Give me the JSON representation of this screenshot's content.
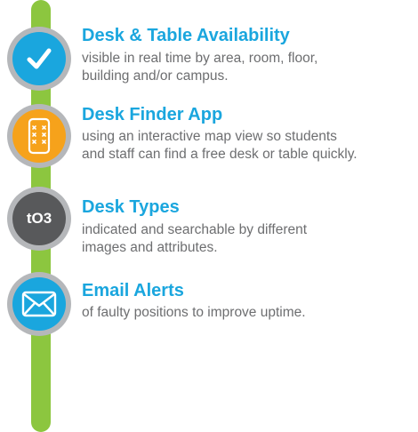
{
  "colors": {
    "rail": "#8cc63f",
    "title": "#1aa6de",
    "text": "#6d6e70",
    "ring": "#b5b7ba",
    "badge_blue": "#1aa6de",
    "badge_orange": "#f6a21b",
    "badge_dark": "#58595b"
  },
  "features": [
    {
      "icon": "checkmark-icon",
      "title": "Desk & Table Availability",
      "lines": [
        "visible in real time by area, room, floor,",
        "building and/or campus."
      ]
    },
    {
      "icon": "phone-app-icon",
      "title": "Desk Finder App",
      "lines": [
        "using an interactive map view so students",
        "and staff can find a free desk or table quickly."
      ]
    },
    {
      "icon": "brand-logo-icon",
      "icon_text": "tO3",
      "title": "Desk Types",
      "lines": [
        "indicated and searchable by different",
        "images and attributes."
      ]
    },
    {
      "icon": "envelope-icon",
      "title": "Email Alerts",
      "lines": [
        "of faulty positions to improve uptime."
      ]
    }
  ]
}
